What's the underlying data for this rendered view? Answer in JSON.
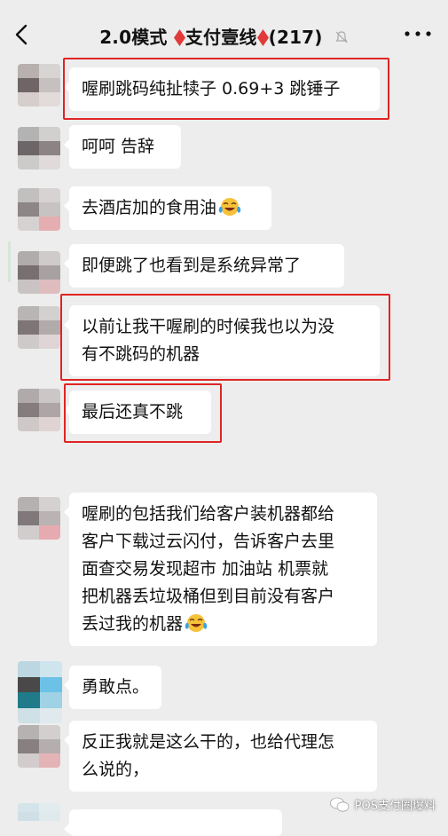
{
  "header": {
    "title_prefix": "2.0模式",
    "title_group": "支付壹线",
    "member_count": "(217)"
  },
  "messages": [
    {
      "text": "喔刷跳码纯扯犊子 0.69+3 跳锤子",
      "highlighted": true
    },
    {
      "text": "呵呵  告辞",
      "highlighted": false
    },
    {
      "text": "去酒店加的食用油",
      "emoji": "crying-laughing-emoji",
      "highlighted": false
    },
    {
      "text": "即便跳了也看到是系统异常了",
      "highlighted": false
    },
    {
      "line1": "以前让我干喔刷的时候我也以为没",
      "line2": "有不跳码的机器",
      "highlighted": true
    },
    {
      "text": "最后还真不跳",
      "highlighted": true
    },
    {
      "line1": "喔刷的包括我们给客户装机器都给",
      "line2": "客户下载过云闪付，告诉客户去里",
      "line3": "面查交易发现超市 加油站 机票就",
      "line4": "把机器丢垃圾桶但到目前没有客户",
      "line5": "丢过我的机器",
      "emoji": "crying-laughing-emoji",
      "highlighted": false
    },
    {
      "text": "勇敢点。",
      "highlighted": false
    },
    {
      "line1": "反正我就是这么干的，也给代理怎",
      "line2": "么说的，",
      "highlighted": false
    }
  ],
  "watermark": "POS支付圈爆料",
  "colors": {
    "highlight": "#e02424",
    "background": "#ededed",
    "bubble": "#ffffff",
    "diamond": "#e23a3a"
  }
}
